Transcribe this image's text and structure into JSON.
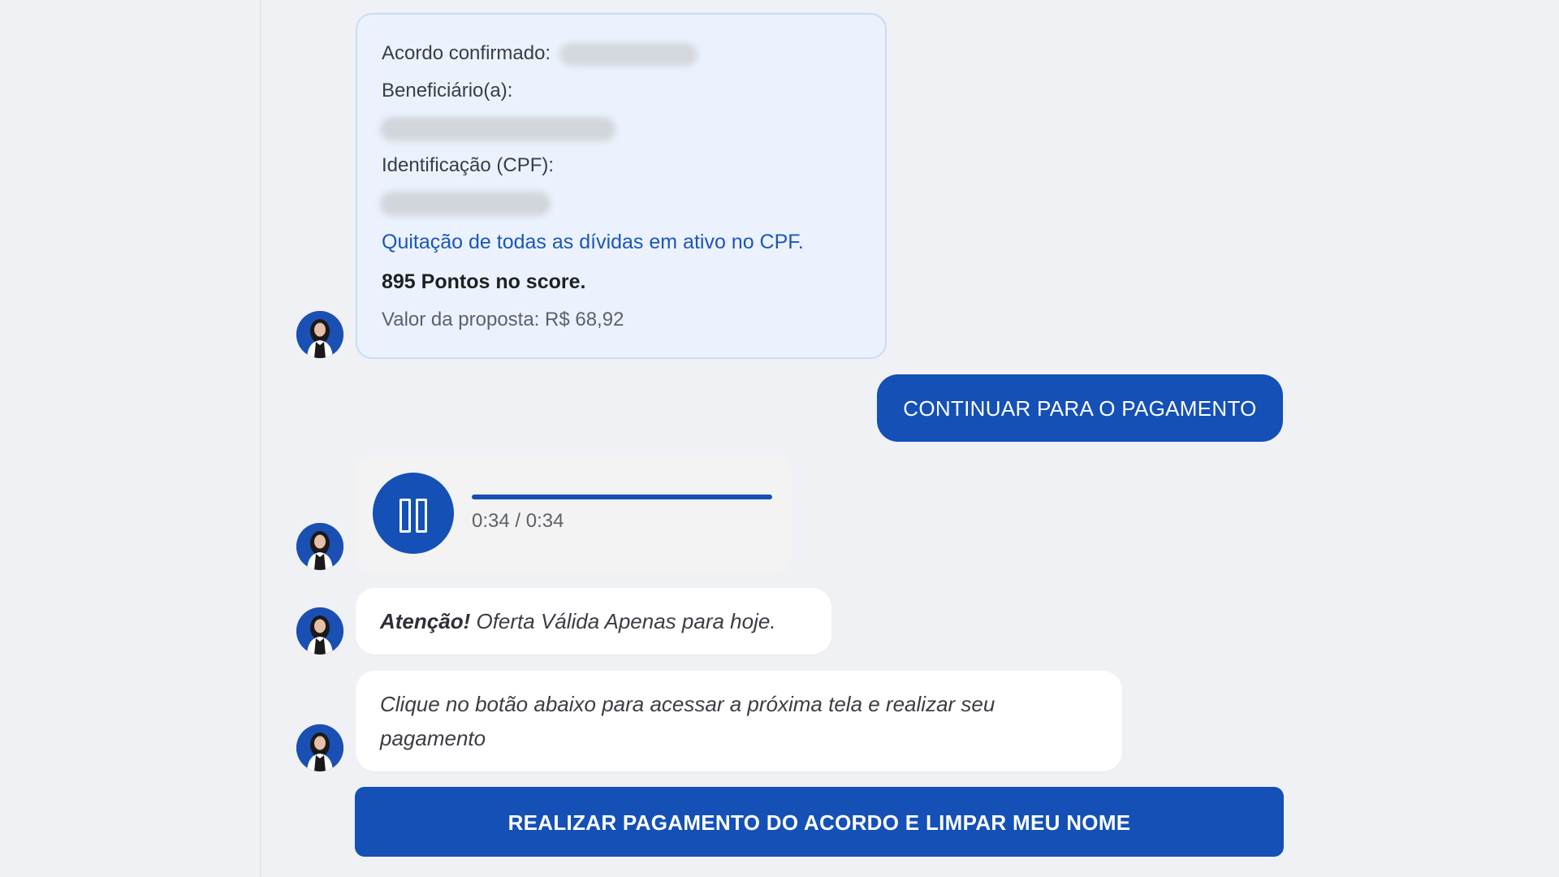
{
  "chat": {
    "agreement_card": {
      "confirmed_label": "Acordo confirmado:",
      "beneficiary_label": "Beneficiário(a):",
      "id_label": "Identificação (CPF):",
      "debt_settlement": "Quitação de todas as dívidas em ativo no CPF.",
      "score_points": "895 Pontos no score.",
      "proposal_value": "Valor da proposta: R$ 68,92"
    },
    "continue_button_label": "CONTINUAR PARA O PAGAMENTO",
    "audio": {
      "time_display": "0:34 / 0:34",
      "progress_fraction": 1.0
    },
    "attention_message": {
      "prefix": "Atenção!",
      "text": "Oferta Válida Apenas para hoje."
    },
    "instruction_message": "Clique no botão abaixo para acessar a próxima tela e realizar seu pagamento",
    "pay_button_label": "REALIZAR PAGAMENTO DO ACORDO E LIMPAR MEU NOME"
  },
  "icons": {
    "avatar": "agent-avatar",
    "audio_control": "pause-icon"
  },
  "colors": {
    "primary": "#1450b6",
    "background": "#f0f1f5",
    "card_background": "#ebf2fd",
    "highlight_text": "#1c56b8"
  }
}
